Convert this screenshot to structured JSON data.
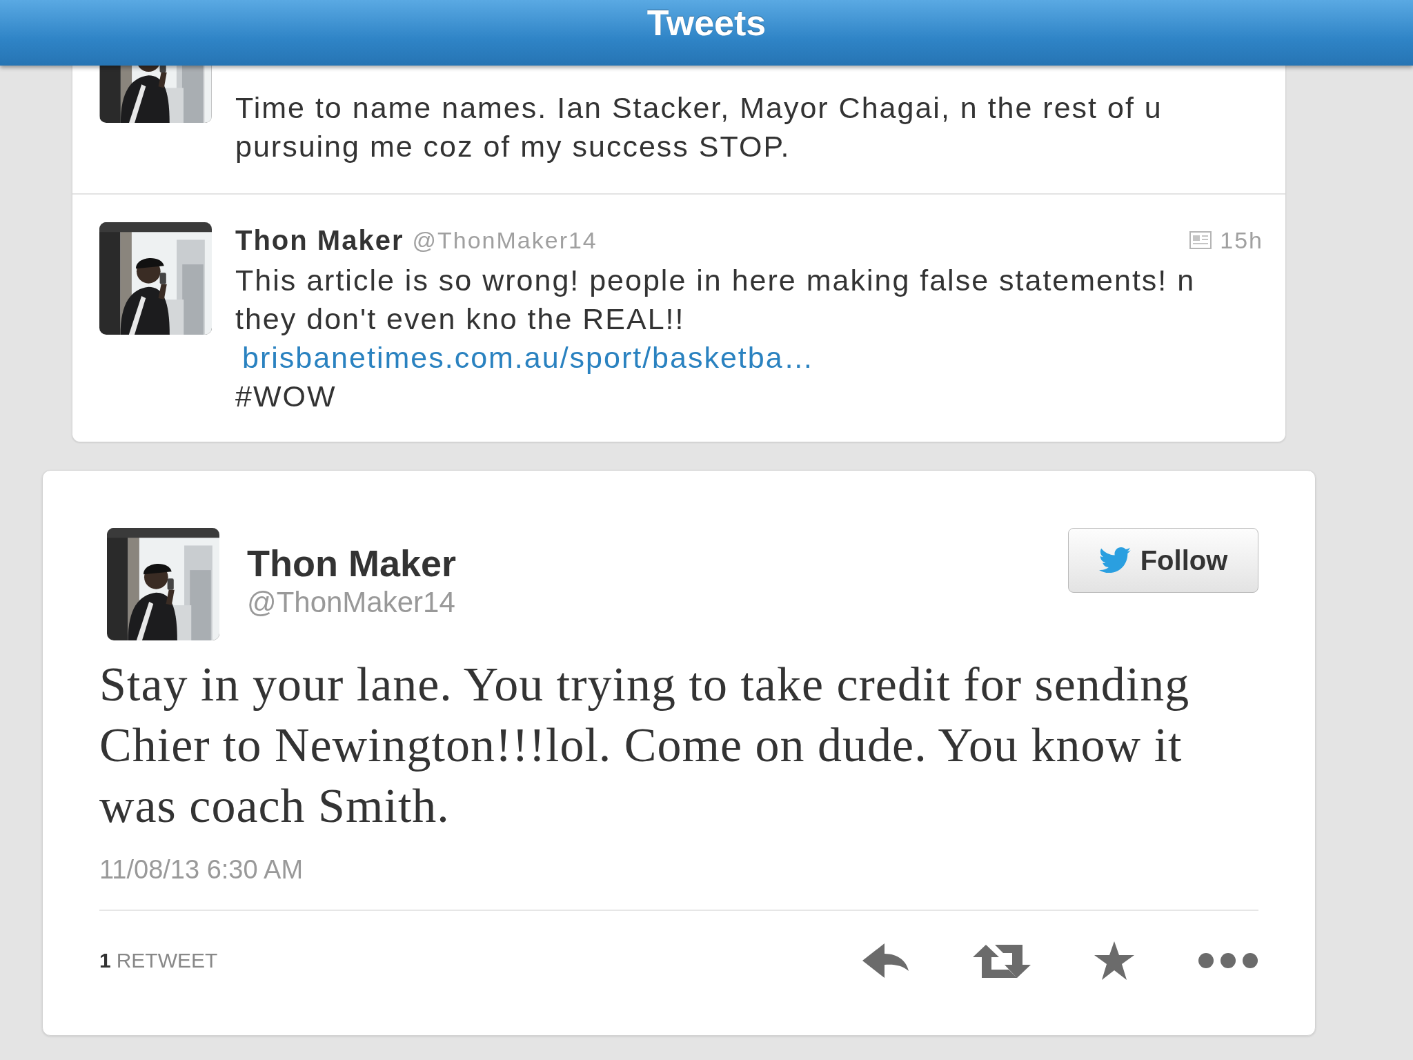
{
  "header": {
    "title": "Tweets"
  },
  "timeline": [
    {
      "avatar": {
        "kind": "picture"
      },
      "paragraphs": [
        {
          "kind": "text",
          "text": "Time to name names. Ian Stacker, Mayor Chagai, n the rest of u pursuing me coz of my success STOP."
        }
      ]
    },
    {
      "avatar": {
        "kind": "picture"
      },
      "name": "Thon Maker",
      "handle": "@ThonMaker14",
      "time": "15h",
      "has_summary": true,
      "paragraphs": [
        {
          "kind": "text",
          "text": "This article is so wrong! people in here making false statements! n they don't even kno the REAL!!"
        },
        {
          "kind": "link",
          "text": "brisbanetimes.com.au/sport/basketba…"
        },
        {
          "kind": "text",
          "text": "#WOW"
        }
      ]
    }
  ],
  "detail": {
    "avatar": {
      "kind": "picture"
    },
    "name": "Thon Maker",
    "handle": "@ThonMaker14",
    "follow_label": "Follow",
    "text": "Stay in your lane. You trying to take credit for sending Chier to Newington!!!lol. Come on dude. You know it was coach Smith.",
    "timestamp": "11/08/13 6:30 AM",
    "retweets": {
      "count": "1",
      "label": "RETWEET"
    },
    "actions": [
      {
        "kind": "reply"
      },
      {
        "kind": "retweet"
      },
      {
        "kind": "favorite"
      },
      {
        "kind": "more"
      }
    ]
  }
}
